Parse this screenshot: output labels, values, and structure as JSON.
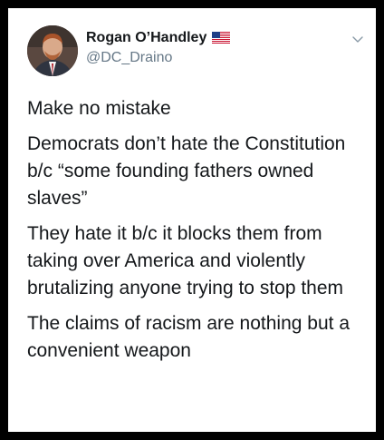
{
  "tweet": {
    "author_name": "Rogan O’Handley",
    "author_handle": "@DC_Draino",
    "flag_icon": "us-flag-icon",
    "menu_icon": "chevron-down-icon",
    "paragraphs": [
      "Make no mistake",
      "Democrats don’t hate the Constitution b/c “some founding fathers owned slaves”",
      "They hate it b/c it blocks them from taking over America and violently brutalizing anyone trying to stop them",
      "The claims of racism are nothing but a convenient weapon"
    ]
  }
}
